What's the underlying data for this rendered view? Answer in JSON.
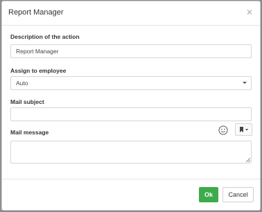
{
  "dialog": {
    "title": "Report Manager",
    "close_icon": "close-icon"
  },
  "form": {
    "description": {
      "label": "Description of the action",
      "value": "Report Manager"
    },
    "assign": {
      "label": "Assign to employee",
      "selected": "Auto"
    },
    "mail_subject": {
      "label": "Mail subject",
      "value": ""
    },
    "mail_message": {
      "label": "Mail message",
      "value": "",
      "emoji_icon": "smiley-icon",
      "bookmark_icon": "bookmark-icon"
    }
  },
  "footer": {
    "ok_label": "Ok",
    "cancel_label": "Cancel"
  },
  "colors": {
    "ok_button": "#3eab4a",
    "backdrop": "#8a8a8a"
  }
}
